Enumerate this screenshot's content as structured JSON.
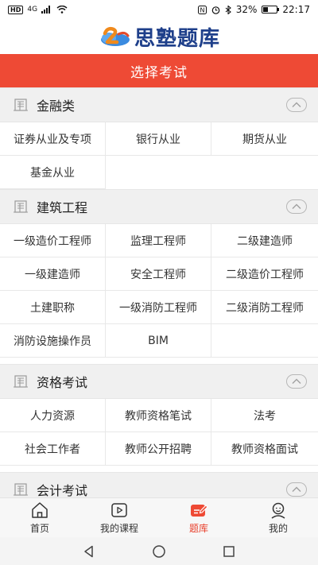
{
  "status_bar": {
    "hd": "HD",
    "signal": "4G",
    "battery_text": "32%",
    "battery_level": 0.32,
    "time": "22:17"
  },
  "brand": {
    "name": "思塾题库"
  },
  "title": "选择考试",
  "sections": [
    {
      "title": "金融类",
      "items": [
        "证券从业及专项",
        "银行从业",
        "期货从业",
        "基金从业"
      ]
    },
    {
      "title": "建筑工程",
      "items": [
        "一级造价工程师",
        "监理工程师",
        "二级建造师",
        "一级建造师",
        "安全工程师",
        "二级造价工程师",
        "土建职称",
        "一级消防工程师",
        "二级消防工程师",
        "消防设施操作员",
        "BIM"
      ]
    },
    {
      "title": "资格考试",
      "items": [
        "人力资源",
        "教师资格笔试",
        "法考",
        "社会工作者",
        "教师公开招聘",
        "教师资格面试"
      ]
    },
    {
      "title": "会计考试",
      "items": []
    }
  ],
  "bottom_nav": [
    {
      "label": "首页",
      "icon": "home-icon"
    },
    {
      "label": "我的课程",
      "icon": "play-icon"
    },
    {
      "label": "题库",
      "icon": "edit-icon",
      "active": true
    },
    {
      "label": "我的",
      "icon": "user-icon"
    }
  ],
  "colors": {
    "accent": "#ee4a35",
    "brand_blue": "#1e3f8a"
  }
}
